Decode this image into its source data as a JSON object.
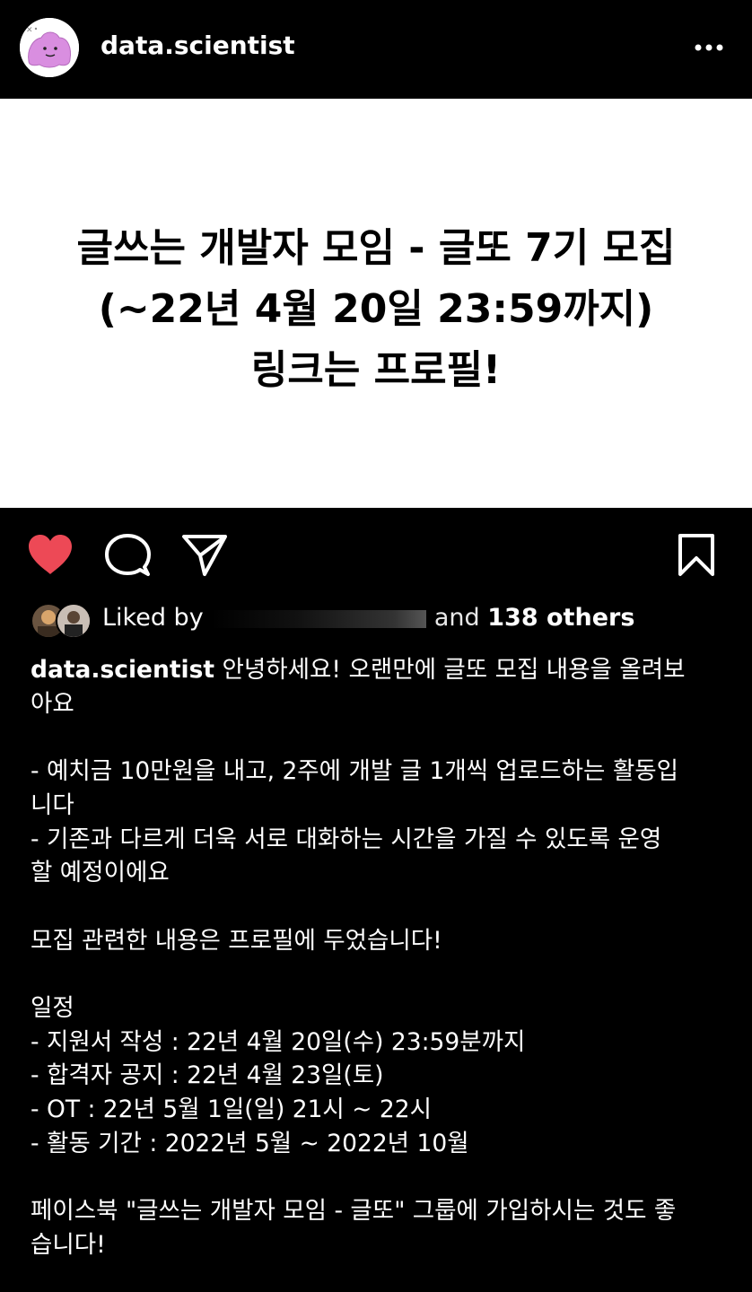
{
  "header": {
    "username": "data.scientist",
    "avatar_icon": "ditto-avatar-icon",
    "more_icon": "more-options-icon"
  },
  "post_image": {
    "line1": "글쓰는 개발자 모임 - 글또 7기 모집",
    "line2": "(~22년 4월 20일 23:59까지)",
    "line3": "링크는 프로필!"
  },
  "actions": {
    "like_icon": "heart-filled-icon",
    "comment_icon": "comment-icon",
    "share_icon": "send-icon",
    "save_icon": "bookmark-icon",
    "like_color": "#ed4956"
  },
  "likes": {
    "prefix": "Liked by",
    "and": "and",
    "count_text": "138 others"
  },
  "caption": {
    "username": "data.scientist",
    "text": " 안녕하세요! 오랜만에 글또 모집 내용을 올려보\n아요\n\n- 예치금 10만원을 내고, 2주에 개발 글 1개씩 업로드하는 활동입\n니다\n- 기존과 다르게 더욱 서로 대화하는 시간을 가질 수 있도록 운영\n할 예정이에요\n\n모집 관련한 내용은 프로필에 두었습니다!\n\n일정\n- 지원서 작성 : 22년 4월 20일(수) 23:59분까지\n- 합격자 공지 : 22년 4월 23일(토)\n- OT : 22년 5월 1일(일) 21시 ~ 22시\n- 활동 기간 : 2022년 5월 ~ 2022년 10월\n\n페이스북 \"글쓰는 개발자 모임 - 글또\" 그룹에 가입하시는 것도 좋\n습니다!"
  }
}
